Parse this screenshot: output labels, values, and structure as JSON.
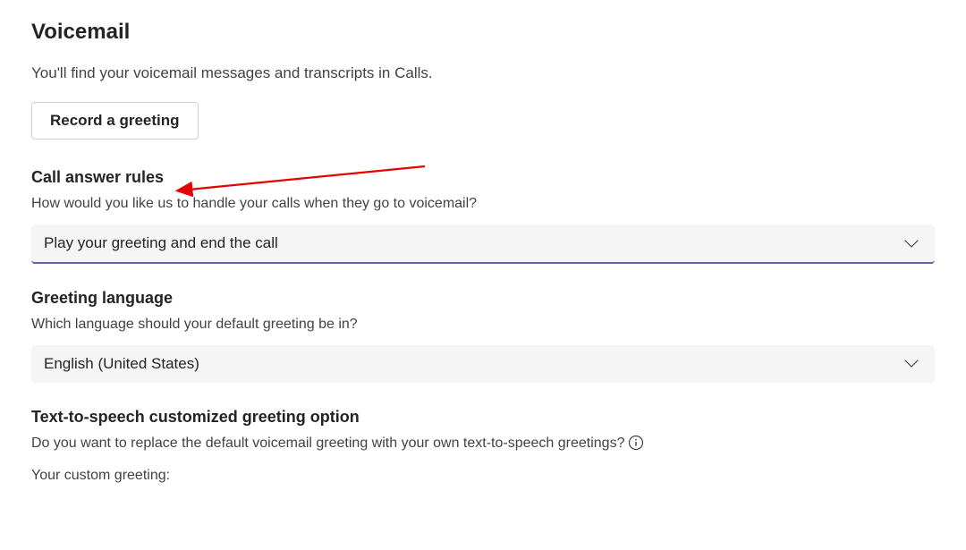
{
  "header": {
    "title": "Voicemail",
    "description": "You'll find your voicemail messages and transcripts in Calls."
  },
  "recordButton": {
    "label": "Record a greeting"
  },
  "callAnswerRules": {
    "heading": "Call answer rules",
    "description": "How would you like us to handle your calls when they go to voicemail?",
    "selected": "Play your greeting and end the call"
  },
  "greetingLanguage": {
    "heading": "Greeting language",
    "description": "Which language should your default greeting be in?",
    "selected": "English (United States)"
  },
  "ttsGreeting": {
    "heading": "Text-to-speech customized greeting option",
    "description": "Do you want to replace the default voicemail greeting with your own text-to-speech greetings?",
    "customLabel": "Your custom greeting:"
  }
}
